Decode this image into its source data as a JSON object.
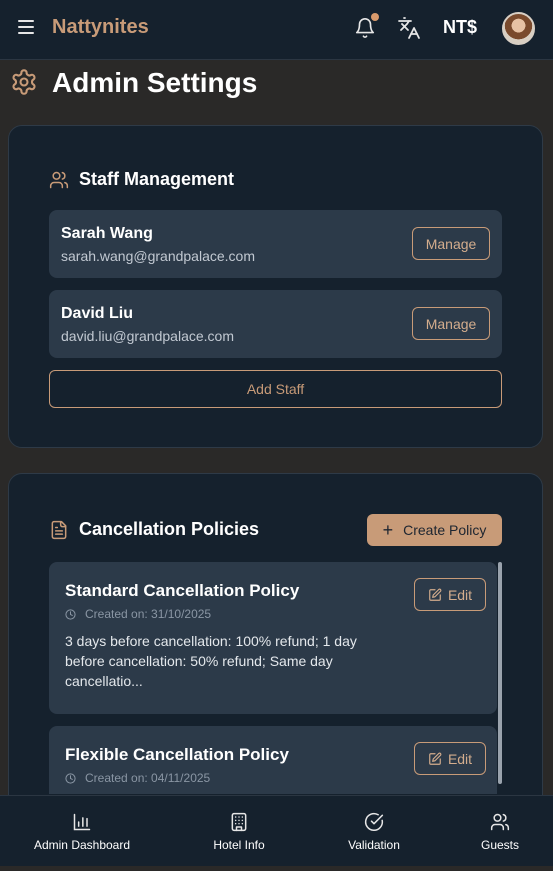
{
  "header": {
    "brand": "Nattynites",
    "currency": "NT$",
    "has_notification": true
  },
  "page": {
    "title": "Admin Settings"
  },
  "staff": {
    "title": "Staff Management",
    "members": [
      {
        "name": "Sarah Wang",
        "email": "sarah.wang@grandpalace.com",
        "action": "Manage"
      },
      {
        "name": "David Liu",
        "email": "david.liu@grandpalace.com",
        "action": "Manage"
      }
    ],
    "add_label": "Add Staff"
  },
  "policies": {
    "title": "Cancellation Policies",
    "create_label": "Create Policy",
    "items": [
      {
        "name": "Standard Cancellation Policy",
        "created": "Created on: 31/10/2025",
        "description": "3 days before cancellation: 100% refund; 1 day before cancellation: 50% refund; Same day cancellatio...",
        "edit_label": "Edit"
      },
      {
        "name": "Flexible Cancellation Policy",
        "created": "Created on: 04/11/2025",
        "description": "",
        "edit_label": "Edit"
      }
    ]
  },
  "nav": [
    {
      "label": "Admin Dashboard",
      "icon": "bar-chart-icon"
    },
    {
      "label": "Hotel Info",
      "icon": "building-icon"
    },
    {
      "label": "Validation",
      "icon": "check-circle-icon"
    },
    {
      "label": "Guests",
      "icon": "users-icon"
    }
  ],
  "colors": {
    "accent": "#c89b78",
    "surface": "#15212d",
    "row": "#2c3a49",
    "background": "#2a2928"
  }
}
